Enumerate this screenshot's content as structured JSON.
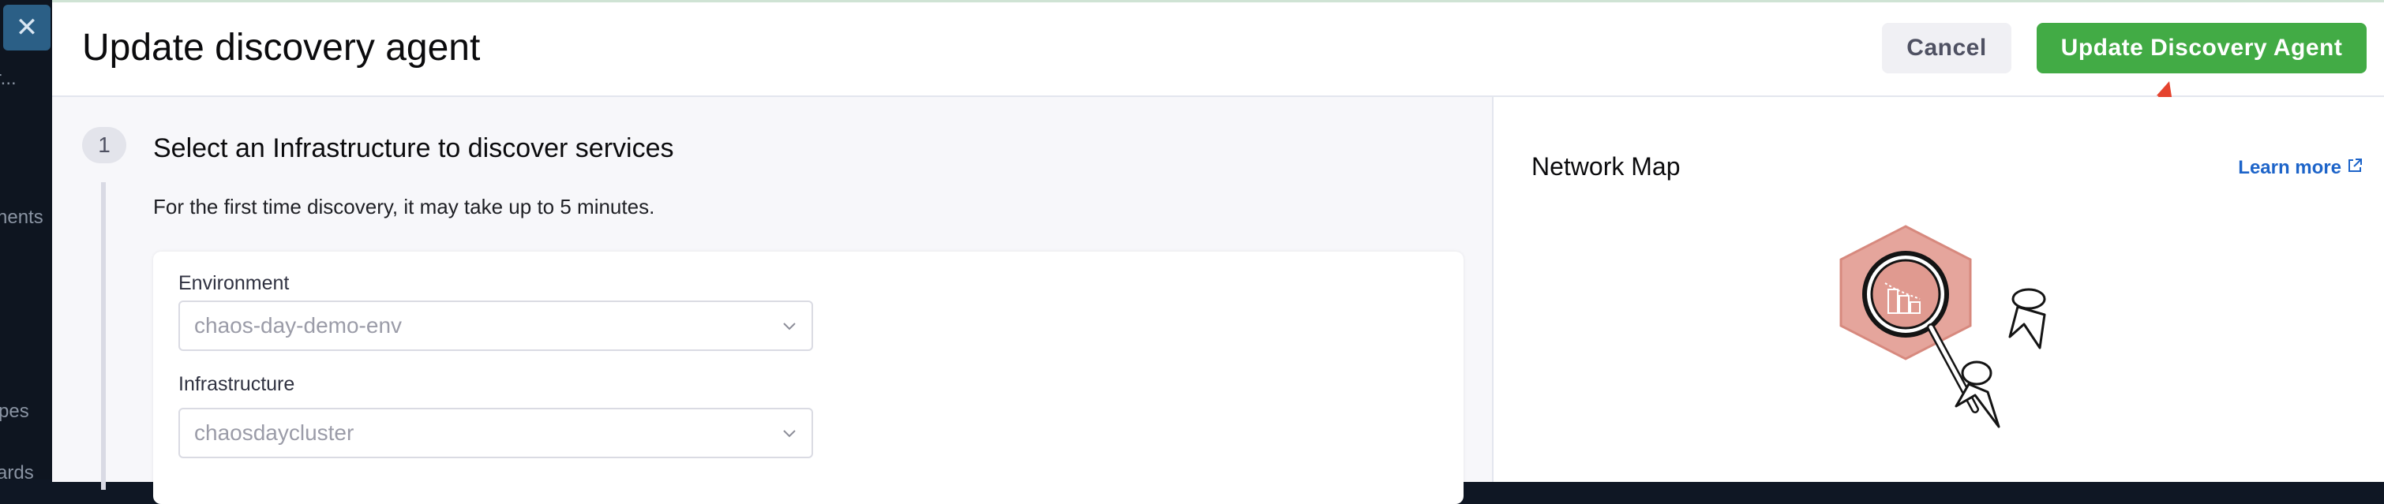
{
  "sidebar": {
    "close_icon": "close-icon",
    "fragments": [
      "r...",
      "nents",
      "pes",
      "ards"
    ]
  },
  "header": {
    "title": "Update discovery agent",
    "cancel_label": "Cancel",
    "primary_label": "Update Discovery Agent",
    "accent_color": "#42ab45"
  },
  "step": {
    "number": "1",
    "title": "Select an Infrastructure to discover services",
    "description": "For the first time discovery, it may take up to 5 minutes."
  },
  "form": {
    "environment": {
      "label": "Environment",
      "value": "chaos-day-demo-env"
    },
    "infrastructure": {
      "label": "Infrastructure",
      "value": "chaosdaycluster"
    }
  },
  "network_map": {
    "title": "Network Map",
    "learn_more_label": "Learn more",
    "illustration": "magnifier-hexagon-illustration"
  }
}
